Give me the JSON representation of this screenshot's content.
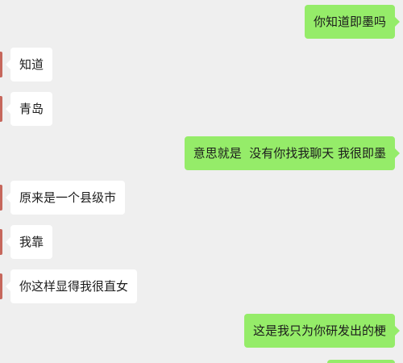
{
  "chat": {
    "messages": [
      {
        "direction": "sent",
        "text": "你知道即墨吗"
      },
      {
        "direction": "received",
        "text": "知道"
      },
      {
        "direction": "received",
        "text": "青岛"
      },
      {
        "direction": "sent",
        "text": "意思就是  没有你找我聊天 我很即墨"
      },
      {
        "direction": "received",
        "text": "原来是一个县级市"
      },
      {
        "direction": "received",
        "text": "我靠"
      },
      {
        "direction": "received",
        "text": "你这样显得我很直女"
      },
      {
        "direction": "sent",
        "text": "这是我只为你研发出的梗"
      }
    ]
  },
  "colors": {
    "background": "#efefef",
    "sent_bubble": "#95ec69",
    "received_bubble": "#ffffff",
    "avatar_accent": "#c6675c"
  }
}
